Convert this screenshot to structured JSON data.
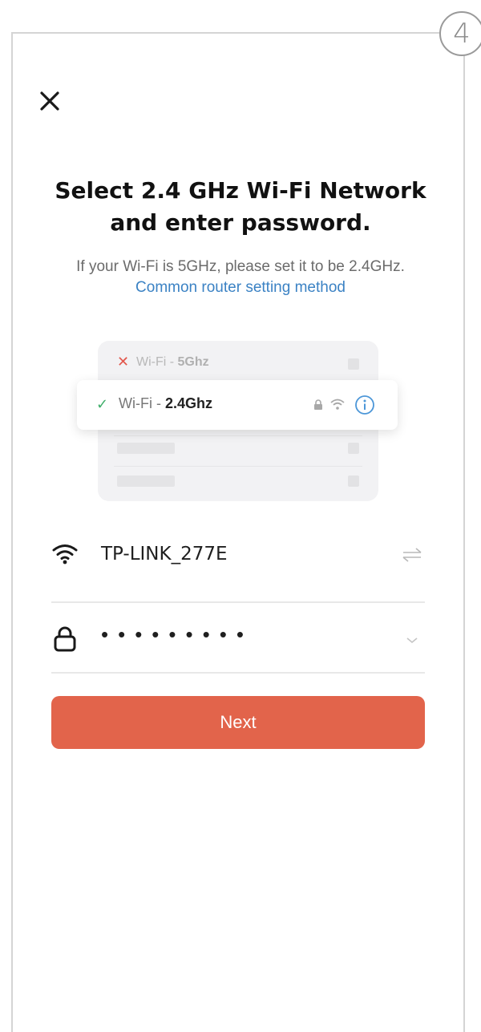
{
  "step_number": "4",
  "title": "Select 2.4 GHz Wi-Fi Network and enter password.",
  "subtitle": {
    "text": "If your Wi-Fi is 5GHz, please set it to be 2.4GHz.",
    "link": "Common router setting method"
  },
  "illustration": {
    "network_5g": {
      "prefix": "Wi-Fi - ",
      "band": "5Ghz",
      "status_icon": "x-mark-icon"
    },
    "network_24g": {
      "prefix": "Wi-Fi - ",
      "band": "2.4Ghz",
      "status_icon": "check-icon"
    }
  },
  "wifi_field": {
    "ssid": "TP-LINK_277E",
    "icon": "wifi-icon",
    "action_icon": "switch-network-icon"
  },
  "password_field": {
    "masked_value": "•••••••••",
    "icon": "lock-icon",
    "action_icon": "chevron-down-icon"
  },
  "next_button": {
    "label": "Next"
  },
  "colors": {
    "accent": "#e2644b",
    "link": "#3b82c4",
    "success": "#3fae6a",
    "error": "#e2574c"
  }
}
